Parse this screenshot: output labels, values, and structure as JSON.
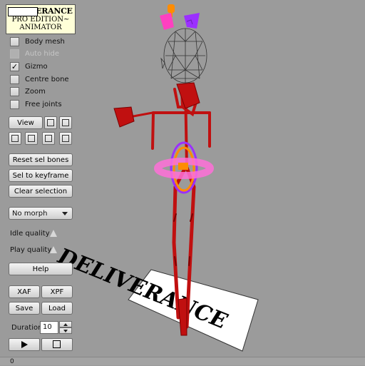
{
  "logo": {
    "line1": "DELIVERANCE",
    "line2": "PRO EDITION~",
    "line3": "ANIMATOR"
  },
  "checkboxes": [
    {
      "label": "Body mesh",
      "checked": false,
      "disabled": false
    },
    {
      "label": "Auto hide",
      "checked": false,
      "disabled": true
    },
    {
      "label": "Gizmo",
      "checked": true,
      "disabled": false
    },
    {
      "label": "Centre bone",
      "checked": false,
      "disabled": false
    },
    {
      "label": "Zoom",
      "checked": false,
      "disabled": false
    },
    {
      "label": "Free joints",
      "checked": false,
      "disabled": false
    }
  ],
  "view": {
    "label": "View"
  },
  "buttons": {
    "reset": "Reset sel bones",
    "sel_to_keyframe": "Sel to keyframe",
    "clear_selection": "Clear selection",
    "help": "Help",
    "xaf": "XAF",
    "xpf": "XPF",
    "save": "Save",
    "load": "Load"
  },
  "morph": {
    "selected": "No morph"
  },
  "quality": {
    "idle": "Idle quality",
    "play": "Play quality"
  },
  "duration": {
    "label": "Duration",
    "value": "10"
  },
  "floor_text": "DELIVERANCE",
  "status": {
    "frame": "0"
  },
  "icons": [
    "play-icon",
    "stop-icon",
    "chevron-down-icon",
    "spin-up-icon",
    "spin-down-icon"
  ],
  "colors": {
    "background": "#9b9b9b",
    "bones": "#c01010",
    "gizmo_ring": "#ff7fe0",
    "gizmo_orange": "#ff8c00",
    "gizmo_purple": "#8a2be2"
  }
}
